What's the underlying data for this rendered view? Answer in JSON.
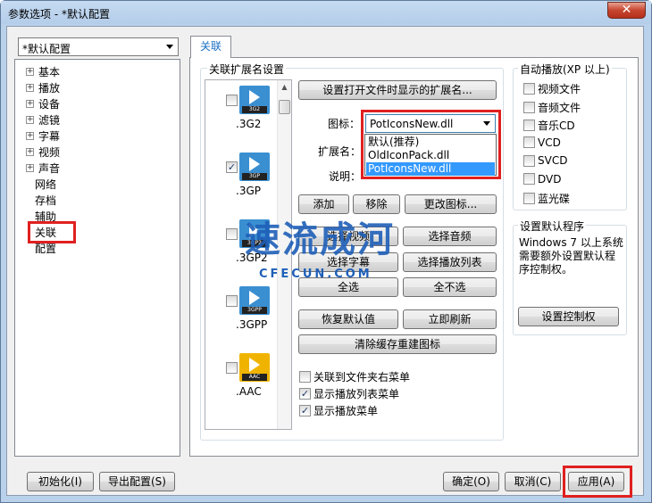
{
  "window": {
    "title": "参数选项 - *默认配置",
    "close": "✕"
  },
  "profile": {
    "selected": "*默认配置"
  },
  "tree": {
    "items": [
      {
        "label": "基本",
        "expandable": true
      },
      {
        "label": "播放",
        "expandable": true
      },
      {
        "label": "设备",
        "expandable": true
      },
      {
        "label": "滤镜",
        "expandable": true
      },
      {
        "label": "字幕",
        "expandable": true
      },
      {
        "label": "视频",
        "expandable": true
      },
      {
        "label": "声音",
        "expandable": true
      },
      {
        "label": "网络",
        "expandable": false
      },
      {
        "label": "存档",
        "expandable": false
      },
      {
        "label": "辅助",
        "expandable": false
      },
      {
        "label": "关联",
        "expandable": false,
        "selected": true
      },
      {
        "label": "配置",
        "expandable": false
      }
    ]
  },
  "tab": {
    "label": "关联"
  },
  "assoc": {
    "group_title": "关联扩展名设置",
    "files": [
      {
        "ext": ".3G2",
        "tag": "3G2",
        "checked": false,
        "color": "#3a8fd1"
      },
      {
        "ext": ".3GP",
        "tag": "3GP",
        "checked": true,
        "color": "#3a8fd1"
      },
      {
        "ext": ".3GP2",
        "tag": "3GP2",
        "checked": false,
        "color": "#3a8fd1"
      },
      {
        "ext": ".3GPP",
        "tag": "3GPP",
        "checked": false,
        "color": "#3a8fd1"
      },
      {
        "ext": ".AAC",
        "tag": "AAC",
        "checked": false,
        "color": "#f0b400"
      }
    ],
    "set_display_btn": "设置打开文件时显示的扩展名...",
    "icon_label": "图标：",
    "icon_selected": "PotIconsNew.dll",
    "icon_options": [
      "默认(推荐)",
      "OldIconPack.dll",
      "PotIconsNew.dll"
    ],
    "ext_label": "扩展名：",
    "desc_label": "说明：",
    "add_btn": "添加",
    "remove_btn": "移除",
    "change_icon_btn": "更改图标...",
    "select_video_btn": "选择视频",
    "select_audio_btn": "选择音频",
    "select_sub_btn": "选择字幕",
    "select_playlist_btn": "选择播放列表",
    "select_all_btn": "全选",
    "select_none_btn": "全不选",
    "restore_btn": "恢复默认值",
    "refresh_btn": "立即刷新",
    "rebuild_btn": "清除缓存重建图标",
    "options": [
      {
        "label": "关联到文件夹右菜单",
        "checked": false
      },
      {
        "label": "显示播放列表菜单",
        "checked": true
      },
      {
        "label": "显示播放菜单",
        "checked": true
      }
    ]
  },
  "autoplay": {
    "title": "自动播放(XP 以上)",
    "items": [
      "视频文件",
      "音频文件",
      "音乐CD",
      "VCD",
      "SVCD",
      "DVD",
      "蓝光碟"
    ]
  },
  "default_prog": {
    "title": "设置默认程序",
    "text_lines": [
      "Windows 7 以上系统",
      "需要额外设置默认程",
      "序控制权。"
    ],
    "btn": "设置控制权"
  },
  "footer": {
    "init": "初始化(I)",
    "export": "导出配置(S)",
    "ok": "确定(O)",
    "cancel": "取消(C)",
    "apply": "应用(A)"
  },
  "watermark": {
    "main": "速流成河",
    "sub": "CFECUN.COM"
  }
}
